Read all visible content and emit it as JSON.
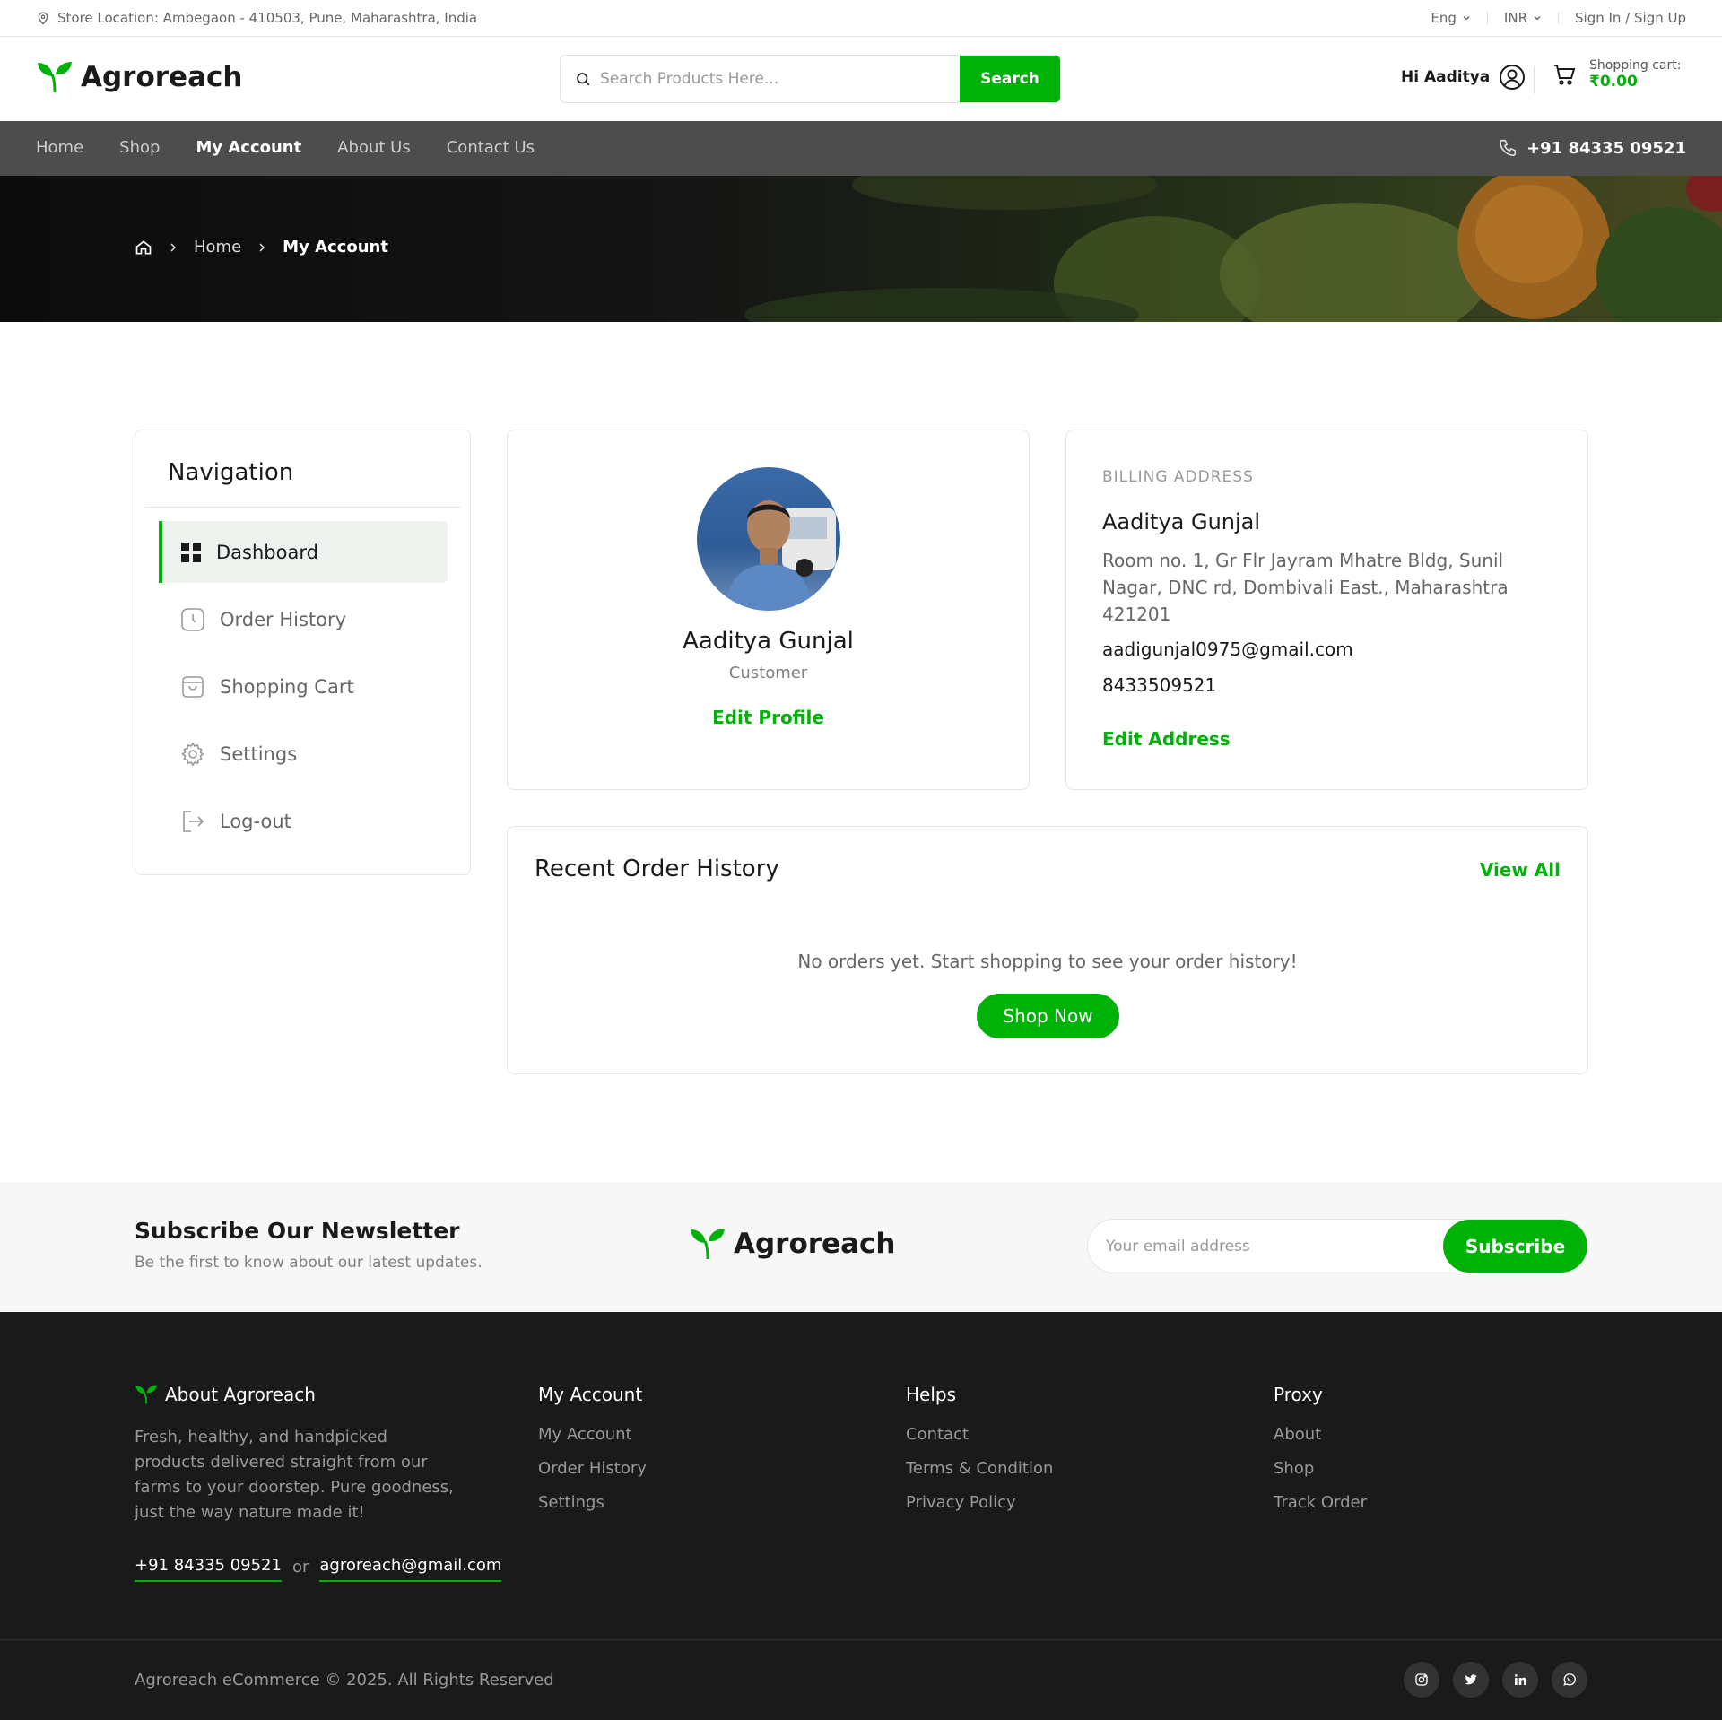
{
  "topbar": {
    "location": "Store Location: Ambegaon - 410503, Pune, Maharashtra, India",
    "language": "Eng",
    "currency": "INR",
    "auth_link": "Sign In / Sign Up"
  },
  "header": {
    "logo_text": "Agroreach",
    "search_placeholder": "Search Products Here...",
    "search_button": "Search",
    "greeting": "Hi Aaditya",
    "cart_label": "Shopping cart:",
    "cart_amount": "₹0.00"
  },
  "nav": {
    "items": [
      {
        "label": "Home"
      },
      {
        "label": "Shop"
      },
      {
        "label": "My Account"
      },
      {
        "label": "About Us"
      },
      {
        "label": "Contact Us"
      }
    ],
    "phone": "+91 84335 09521"
  },
  "breadcrumb": {
    "home": "Home",
    "current": "My Account"
  },
  "sidebar": {
    "title": "Navigation",
    "items": [
      {
        "label": "Dashboard",
        "icon": "dashboard-icon"
      },
      {
        "label": "Order History",
        "icon": "clock-icon"
      },
      {
        "label": "Shopping Cart",
        "icon": "bag-icon"
      },
      {
        "label": "Settings",
        "icon": "gear-icon"
      },
      {
        "label": "Log-out",
        "icon": "logout-icon"
      }
    ]
  },
  "profile": {
    "name": "Aaditya Gunjal",
    "role": "Customer",
    "edit_label": "Edit Profile"
  },
  "billing": {
    "label": "BILLING ADDRESS",
    "name": "Aaditya Gunjal",
    "address": "Room no. 1, Gr Flr Jayram Mhatre Bldg, Sunil Nagar, DNC rd, Dombivali East., Maharashtra 421201",
    "email": "aadigunjal0975@gmail.com",
    "phone": "8433509521",
    "edit_label": "Edit Address"
  },
  "orders": {
    "title": "Recent Order History",
    "view_all": "View All",
    "empty_message": "No orders yet. Start shopping to see your order history!",
    "shop_button": "Shop Now"
  },
  "newsletter": {
    "title": "Subscribe Our Newsletter",
    "subtitle": "Be the first to know about our latest updates.",
    "logo_text": "Agroreach",
    "email_placeholder": "Your email address",
    "button": "Subscribe"
  },
  "footer": {
    "about_title": "About Agroreach",
    "about_text": "Fresh, healthy, and handpicked products delivered straight from our farms to your doorstep. Pure goodness, just the way nature made it!",
    "contact_phone": "+91 84335 09521",
    "contact_or": "or",
    "contact_email": "agroreach@gmail.com",
    "columns": [
      {
        "title": "My Account",
        "links": [
          "My Account",
          "Order History",
          "Settings"
        ]
      },
      {
        "title": "Helps",
        "links": [
          "Contact",
          "Terms & Condition",
          "Privacy Policy"
        ]
      },
      {
        "title": "Proxy",
        "links": [
          "About",
          "Shop",
          "Track Order"
        ]
      }
    ],
    "copyright": "Agroreach eCommerce © 2025. All Rights Reserved",
    "social": [
      "instagram-icon",
      "twitter-icon",
      "linkedin-icon",
      "whatsapp-icon"
    ]
  },
  "colors": {
    "accent": "#00b207",
    "nav_bg": "#4d4d4d",
    "footer_bg": "#1a1a1a"
  }
}
